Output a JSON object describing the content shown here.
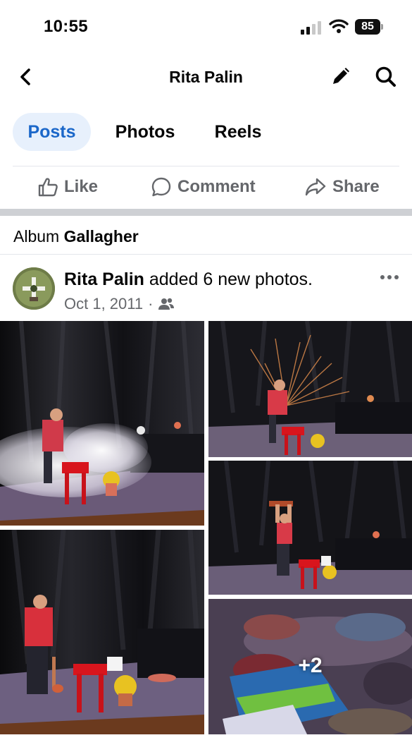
{
  "status_bar": {
    "time": "10:55",
    "battery": "85",
    "icons": [
      "signal-icon",
      "wifi-icon",
      "battery-icon"
    ]
  },
  "header": {
    "title": "Rita Palin",
    "icons": [
      "back-chevron-icon",
      "pencil-icon",
      "search-icon"
    ]
  },
  "tabs": [
    {
      "label": "Posts",
      "active": true
    },
    {
      "label": "Photos",
      "active": false
    },
    {
      "label": "Reels",
      "active": false
    }
  ],
  "actions": {
    "like": "Like",
    "comment": "Comment",
    "share": "Share"
  },
  "album": {
    "prefix": "Album",
    "name": "Gallagher"
  },
  "post": {
    "author": "Rita Palin",
    "action_text": "added 6 new photos.",
    "date": "Oct 1, 2011",
    "separator": "·",
    "audience_icon": "friends-icon",
    "photos": [
      {
        "desc": "performer-smashing-with-smoke"
      },
      {
        "desc": "performer-sparks"
      },
      {
        "desc": "performer-mallet-raised"
      },
      {
        "desc": "performer-saluting"
      },
      {
        "desc": "smashed-food-closeup"
      }
    ],
    "more_photos": "+2"
  },
  "colors": {
    "accent": "#1b67c9",
    "accent_bg": "#e7f0fc",
    "secondary_text": "#65676b",
    "separator": "#ced0d4"
  }
}
